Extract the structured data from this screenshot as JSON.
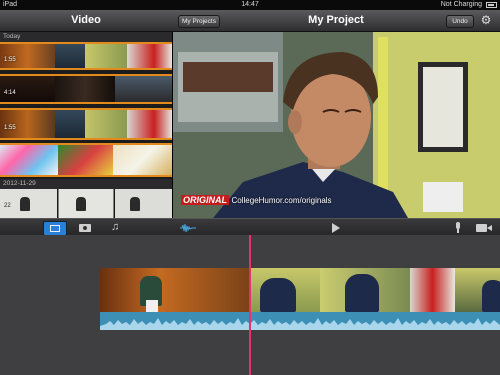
{
  "status_bar": {
    "device": "iPad",
    "time": "14:47",
    "charging": "Not Charging"
  },
  "header": {
    "left_title": "Video",
    "right_title": "My Project",
    "my_projects_label": "My Projects",
    "undo_label": "Undo",
    "settings_icon": "gear-icon"
  },
  "browser": {
    "sections": [
      {
        "date": "Today",
        "clips": [
          {
            "duration": "1:55"
          },
          {
            "duration": "4:14"
          },
          {
            "duration": "1:55"
          },
          {
            "duration": ""
          }
        ]
      },
      {
        "date": "2012-11-29",
        "clips": [
          {
            "duration": "22"
          }
        ]
      }
    ]
  },
  "viewer": {
    "watermark_brand": "ORIGINAL",
    "watermark_url": "CollegeHumor.com/originals"
  },
  "toolbar": {
    "media_tabs": [
      "video-tab",
      "photo-tab",
      "music-tab"
    ],
    "active_tab": "video-tab",
    "icons": [
      "audio-waveform-icon",
      "play-icon",
      "microphone-icon",
      "camera-icon"
    ]
  },
  "colors": {
    "selection": "#e38a1c",
    "playhead": "#e8306f",
    "waveform": "#3d8fb5",
    "active_tab": "#2a7fd6"
  }
}
